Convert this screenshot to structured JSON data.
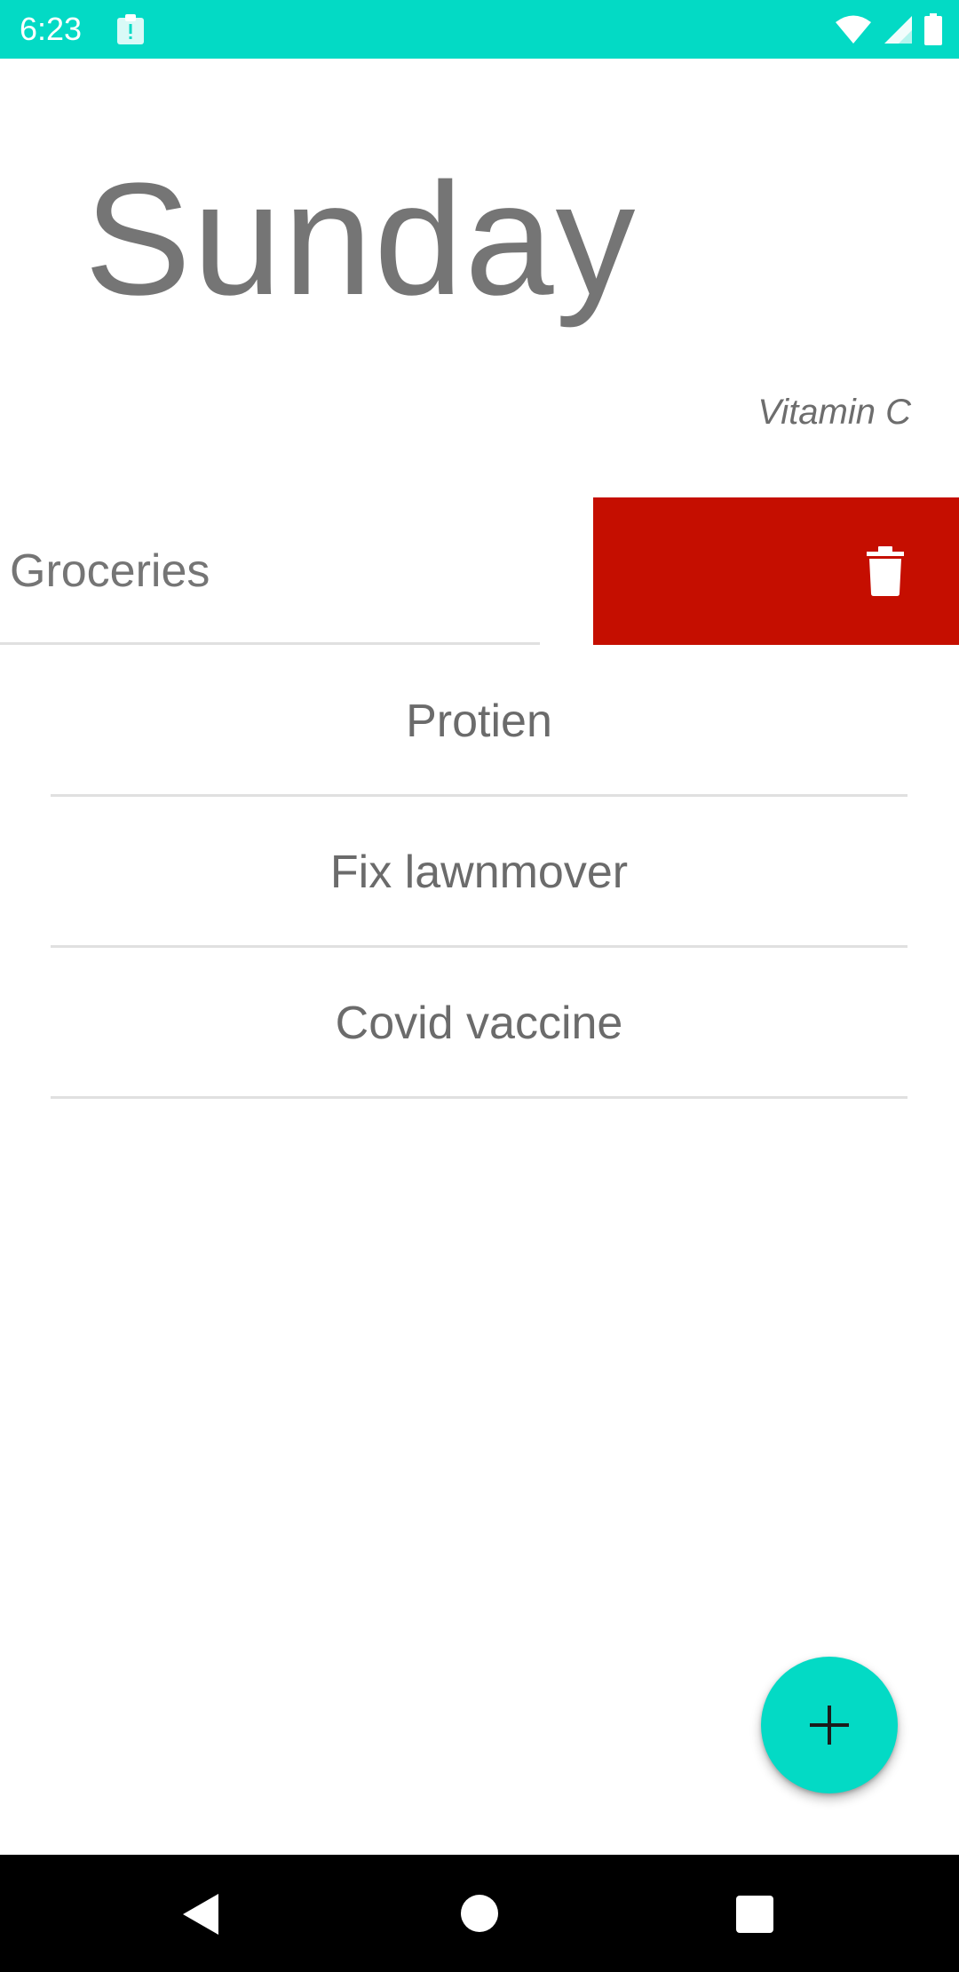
{
  "status_bar": {
    "time": "6:23",
    "icons": [
      "clipboard-alert-icon",
      "wifi-icon",
      "cell-signal-icon",
      "battery-icon"
    ],
    "background": "#03dac5"
  },
  "header": {
    "title": "Sunday",
    "subtitle": "Vitamin C"
  },
  "swiped_item": {
    "label": "Groceries",
    "action_icon": "trash-icon",
    "action_color": "#c50e00"
  },
  "tasks": [
    {
      "label": "Protien"
    },
    {
      "label": "Fix lawnmover"
    },
    {
      "label": "Covid vaccine"
    }
  ],
  "fab": {
    "icon": "plus-icon",
    "color": "#03dac5"
  },
  "nav_bar": {
    "buttons": [
      "back-icon",
      "home-icon",
      "recents-icon"
    ]
  }
}
